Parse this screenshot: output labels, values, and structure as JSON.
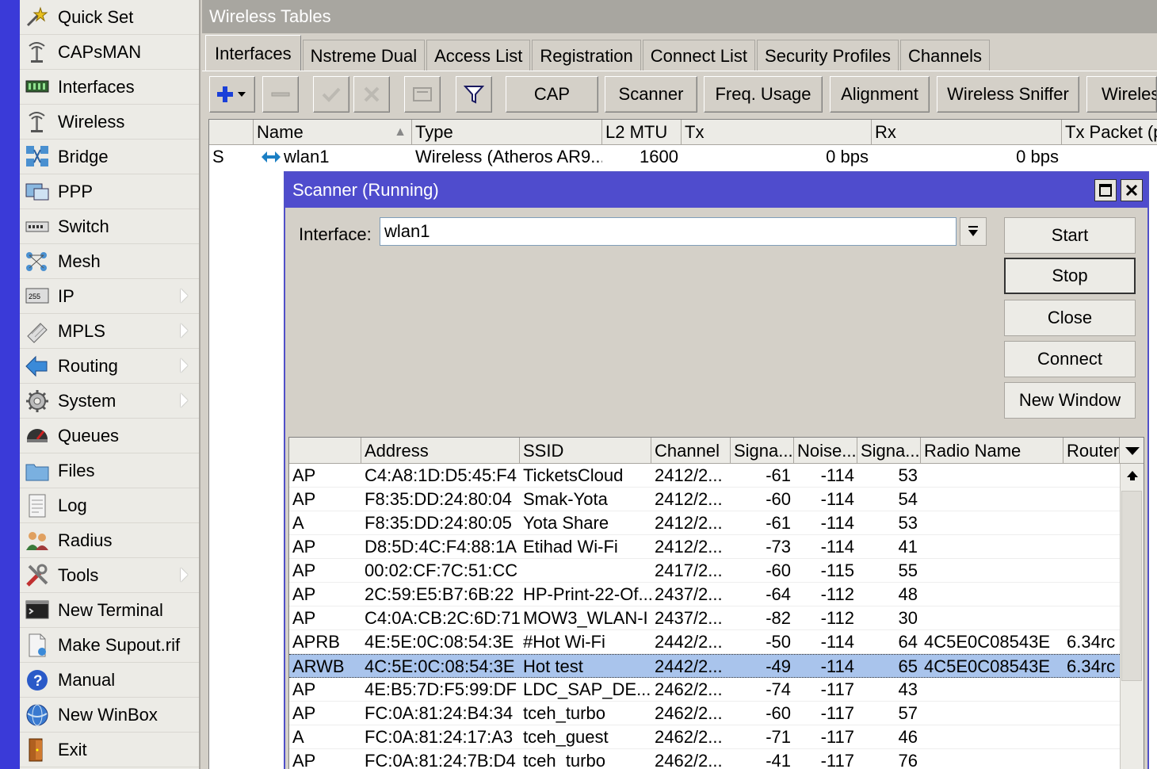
{
  "sidebar": {
    "items": [
      {
        "label": "Quick Set",
        "icon": "wand-icon",
        "submenu": false
      },
      {
        "label": "CAPsMAN",
        "icon": "antenna-icon",
        "submenu": false
      },
      {
        "label": "Interfaces",
        "icon": "interfaces-icon",
        "submenu": false
      },
      {
        "label": "Wireless",
        "icon": "antenna-icon",
        "submenu": false
      },
      {
        "label": "Bridge",
        "icon": "bridge-icon",
        "submenu": false
      },
      {
        "label": "PPP",
        "icon": "ppp-icon",
        "submenu": false
      },
      {
        "label": "Switch",
        "icon": "switch-icon",
        "submenu": false
      },
      {
        "label": "Mesh",
        "icon": "mesh-icon",
        "submenu": false
      },
      {
        "label": "IP",
        "icon": "ip-icon",
        "submenu": true
      },
      {
        "label": "MPLS",
        "icon": "mpls-icon",
        "submenu": true
      },
      {
        "label": "Routing",
        "icon": "routing-icon",
        "submenu": true
      },
      {
        "label": "System",
        "icon": "gear-icon",
        "submenu": true
      },
      {
        "label": "Queues",
        "icon": "queues-icon",
        "submenu": false
      },
      {
        "label": "Files",
        "icon": "folder-icon",
        "submenu": false
      },
      {
        "label": "Log",
        "icon": "log-icon",
        "submenu": false
      },
      {
        "label": "Radius",
        "icon": "users-icon",
        "submenu": false
      },
      {
        "label": "Tools",
        "icon": "tools-icon",
        "submenu": true
      },
      {
        "label": "New Terminal",
        "icon": "terminal-icon",
        "submenu": false
      },
      {
        "label": "Make Supout.rif",
        "icon": "document-icon",
        "submenu": false
      },
      {
        "label": "Manual",
        "icon": "help-icon",
        "submenu": false
      },
      {
        "label": "New WinBox",
        "icon": "globe-icon",
        "submenu": false
      },
      {
        "label": "Exit",
        "icon": "exit-door-icon",
        "submenu": false
      }
    ]
  },
  "window": {
    "title": "Wireless Tables",
    "tabs": [
      "Interfaces",
      "Nstreme Dual",
      "Access List",
      "Registration",
      "Connect List",
      "Security Profiles",
      "Channels"
    ],
    "active_tab": "Interfaces"
  },
  "toolbar": {
    "buttons": [
      "CAP",
      "Scanner",
      "Freq. Usage",
      "Alignment",
      "Wireless Sniffer",
      "Wireles"
    ]
  },
  "interfaces_table": {
    "columns": [
      "",
      "Name",
      "Type",
      "L2 MTU",
      "Tx",
      "Rx",
      "Tx Packet (p"
    ],
    "rows": [
      {
        "flag": "S",
        "name": "wlan1",
        "type": "Wireless (Atheros AR9...",
        "l2mtu": "1600",
        "tx": "0 bps",
        "rx": "0 bps",
        "txp": ""
      }
    ]
  },
  "scanner": {
    "title": "Scanner (Running)",
    "interface_label": "Interface:",
    "interface_value": "wlan1",
    "buttons": {
      "start": "Start",
      "stop": "Stop",
      "close": "Close",
      "connect": "Connect",
      "new_window": "New Window"
    },
    "columns": [
      "",
      "Address",
      "SSID",
      "Channel",
      "Signa...",
      "Noise...",
      "Signa...",
      "Radio Name",
      "Router"
    ],
    "rows": [
      [
        "AP",
        "C4:A8:1D:D5:45:F4",
        "TicketsCloud",
        "2412/2...",
        "-61",
        "-114",
        "53",
        "",
        ""
      ],
      [
        "AP",
        "F8:35:DD:24:80:04",
        "Smak-Yota",
        "2412/2...",
        "-60",
        "-114",
        "54",
        "",
        ""
      ],
      [
        "A",
        "F8:35:DD:24:80:05",
        "Yota Share",
        "2412/2...",
        "-61",
        "-114",
        "53",
        "",
        ""
      ],
      [
        "AP",
        "D8:5D:4C:F4:88:1A",
        "Etihad Wi-Fi",
        "2412/2...",
        "-73",
        "-114",
        "41",
        "",
        ""
      ],
      [
        "AP",
        "00:02:CF:7C:51:CC",
        "",
        "2417/2...",
        "-60",
        "-115",
        "55",
        "",
        ""
      ],
      [
        "AP",
        "2C:59:E5:B7:6B:22",
        "HP-Print-22-Of...",
        "2437/2...",
        "-64",
        "-112",
        "48",
        "",
        ""
      ],
      [
        "AP",
        "C4:0A:CB:2C:6D:71",
        "MOW3_WLAN-I",
        "2437/2...",
        "-82",
        "-112",
        "30",
        "",
        ""
      ],
      [
        "APRB",
        "4E:5E:0C:08:54:3E",
        "#Hot Wi-Fi",
        "2442/2...",
        "-50",
        "-114",
        "64",
        "4C5E0C08543E",
        "6.34rc"
      ],
      [
        "ARWB",
        "4C:5E:0C:08:54:3E",
        "Hot test",
        "2442/2...",
        "-49",
        "-114",
        "65",
        "4C5E0C08543E",
        "6.34rc"
      ],
      [
        "AP",
        "4E:B5:7D:F5:99:DF",
        "LDC_SAP_DE...",
        "2462/2...",
        "-74",
        "-117",
        "43",
        "",
        ""
      ],
      [
        "AP",
        "FC:0A:81:24:B4:34",
        "tceh_turbo",
        "2462/2...",
        "-60",
        "-117",
        "57",
        "",
        ""
      ],
      [
        "A",
        "FC:0A:81:24:17:A3",
        "tceh_guest",
        "2462/2...",
        "-71",
        "-117",
        "46",
        "",
        ""
      ],
      [
        "AP",
        "FC:0A:81:24:7B:D4",
        "tceh_turbo",
        "2462/2...",
        "-41",
        "-117",
        "76",
        "",
        ""
      ]
    ],
    "selected_row": 8
  }
}
